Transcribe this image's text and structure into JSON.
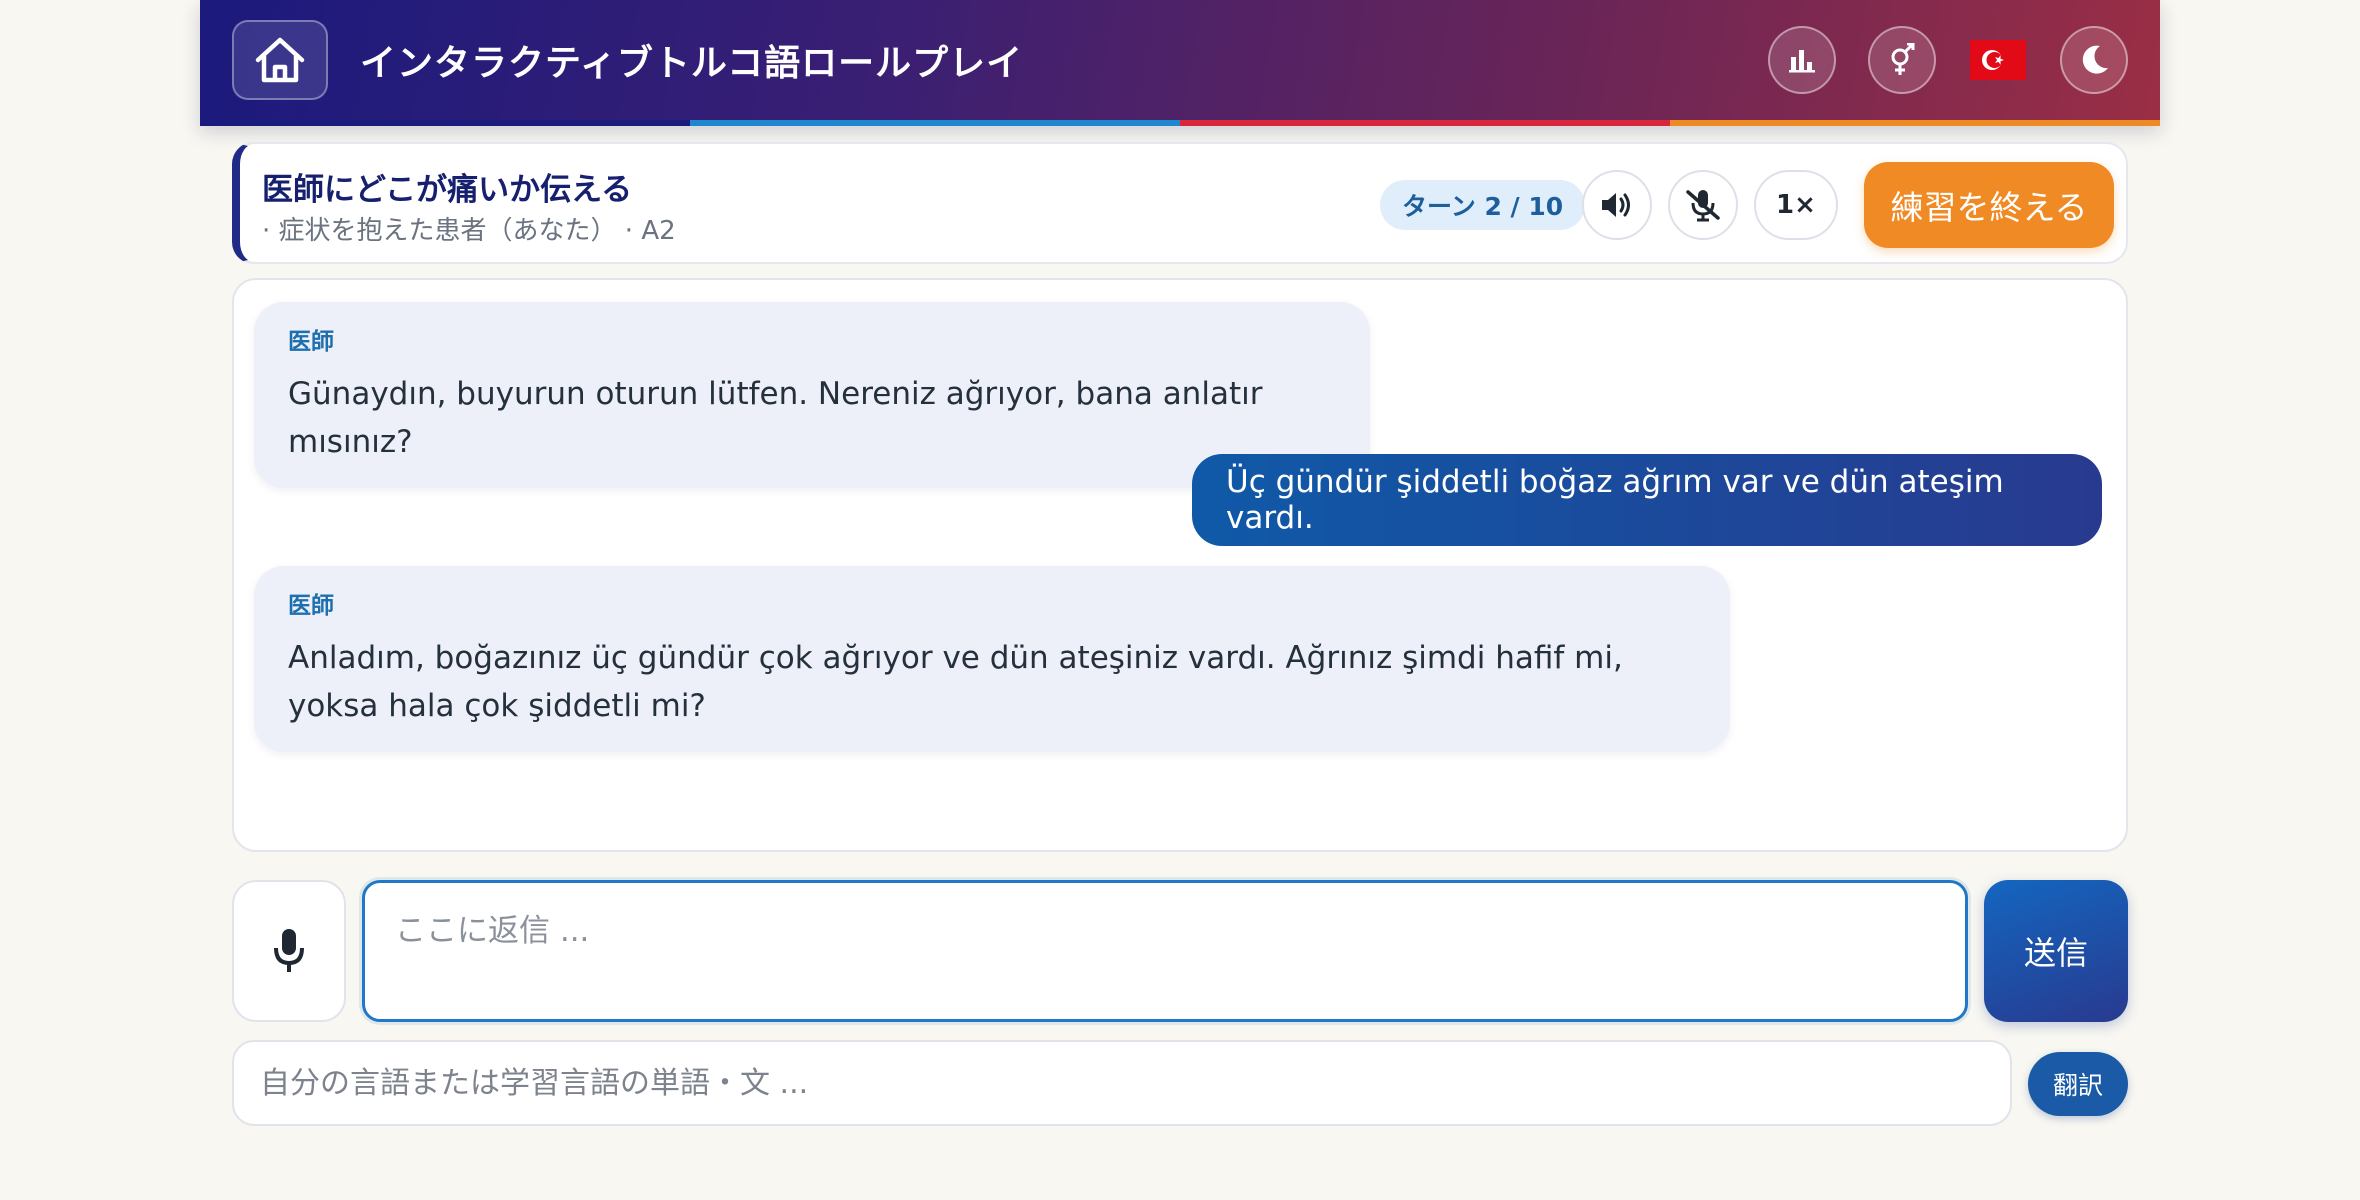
{
  "header": {
    "title": "インタラクティブトルコ語ロールプレイ",
    "home_icon": "home-icon",
    "stats_icon": "bar-chart-icon",
    "gender_icon": "gender-icon",
    "flag_icon": "turkish-flag-icon",
    "theme_icon": "moon-icon",
    "stripe_colors": [
      "#1b1a7d",
      "#1f86d0",
      "#d8263c",
      "#ee8a24"
    ]
  },
  "scenario": {
    "title": "医師にどこが痛いか伝える",
    "subtitle": "· 症状を抱えた患者（あなた） · A2",
    "turn_label": "ターン 2 / 10",
    "speed_label": "1×",
    "end_label": "練習を終える",
    "volume_icon": "volume-icon",
    "mute_mic_icon": "mic-off-icon"
  },
  "chat": {
    "messages": [
      {
        "role": "partner",
        "speaker": "医師",
        "text": "Günaydın, buyurun oturun lütfen. Nereniz ağrıyor, bana anlatır mısınız?"
      },
      {
        "role": "user",
        "text": "Üç gündür şiddetli boğaz ağrım var ve dün ateşim vardı."
      },
      {
        "role": "partner",
        "speaker": "医師",
        "text": "Anladım, boğazınız üç gündür çok ağrıyor ve dün ateşiniz vardı. Ağrınız şimdi hafif mi, yoksa hala çok şiddetli mi?"
      }
    ]
  },
  "input": {
    "reply_placeholder": "ここに返信 ...",
    "reply_value": "",
    "send_label": "送信",
    "mic_icon": "microphone-icon",
    "translate_placeholder": "自分の言語または学習言語の単語・文 ...",
    "translate_label": "翻訳"
  },
  "colors": {
    "accent_blue": "#1466c0",
    "end_orange": "#f08a24",
    "bubble_partner": "#edf0f8"
  }
}
